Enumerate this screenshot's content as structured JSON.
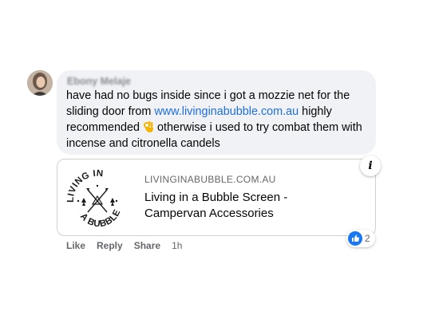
{
  "comment": {
    "author": "Ebony Melaje",
    "author_visible_suffix": "je",
    "text_before_link": "have had no bugs inside since i got a mozzie net for the sliding door from ",
    "link_text": "www.livinginabubble.com.au",
    "text_after_link": " highly recommended ",
    "text_end": " otherwise i used to try combat them with incense and citronella candels"
  },
  "link_preview": {
    "domain": "LIVINGINABUBBLE.COM.AU",
    "title": "Living in a Bubble Screen - Campervan Accessories",
    "logo_text_top": "LIVING IN",
    "logo_text_bottom": "A BUBBLE"
  },
  "reactions": {
    "icon": "like-icon",
    "count": "2"
  },
  "actions": {
    "like": "Like",
    "reply": "Reply",
    "share": "Share",
    "time": "1h"
  },
  "colors": {
    "link": "#216fdb",
    "bubble": "#f0f2f5",
    "like_blue": "#1877f2"
  }
}
